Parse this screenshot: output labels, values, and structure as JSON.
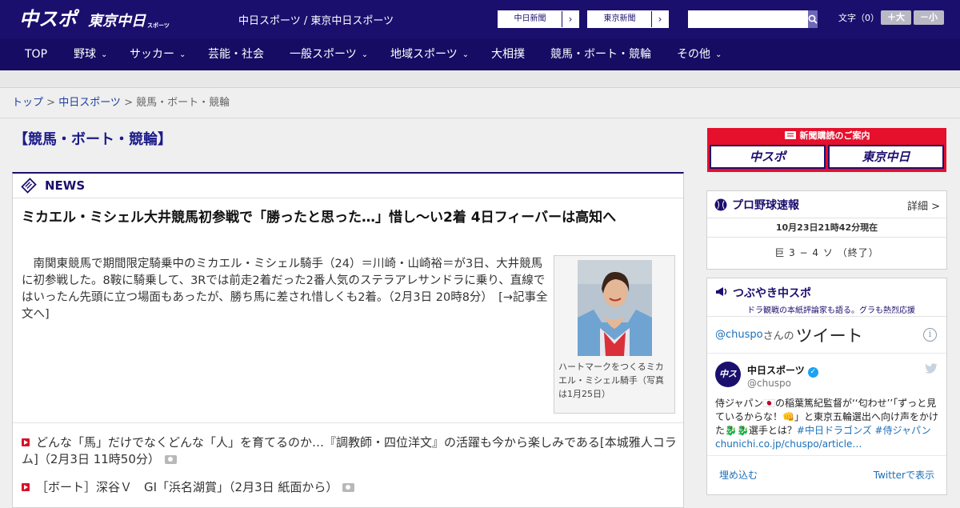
{
  "header": {
    "logo_main": "中スポ",
    "logo_sub": "東京中日",
    "logo_sub2": "スポーツ",
    "tagline": "中日スポーツ / 東京中日スポーツ",
    "btn_chunichi": "中日新聞",
    "btn_tokyo": "東京新聞",
    "arrow": "›",
    "search_placeholder": "",
    "font_label": "文字（0）",
    "font_bigger": "＋大",
    "font_smaller": "－小"
  },
  "nav": {
    "items": [
      {
        "label": "TOP",
        "dropdown": false
      },
      {
        "label": "野球",
        "dropdown": true
      },
      {
        "label": "サッカー",
        "dropdown": true
      },
      {
        "label": "芸能・社会",
        "dropdown": false
      },
      {
        "label": "一般スポーツ",
        "dropdown": true
      },
      {
        "label": "地域スポーツ",
        "dropdown": true
      },
      {
        "label": "大相撲",
        "dropdown": false
      },
      {
        "label": "競馬・ボート・競輪",
        "dropdown": false
      },
      {
        "label": "その他",
        "dropdown": true
      }
    ],
    "chevron": "⌄"
  },
  "breadcrumb": {
    "home": "トップ",
    "sep": " > ",
    "section": "中日スポーツ",
    "current": "競馬・ボート・競輪"
  },
  "page": {
    "category_title": "【競馬・ボート・競輪】"
  },
  "news": {
    "section_title": "NEWS",
    "headline": "ミカエル・ミシェル大井競馬初参戦で「勝ったと思った…」惜し～い2着 4日フィーバーは高知へ",
    "lead": "　南関東競馬で期間限定騎乗中のミカエル・ミシェル騎手（24）＝川崎・山崎裕＝が3日、大井競馬に初参戦した。8鞍に騎乗して、3Rでは前走2着だった2番人気のステラアレサンドラに乗り、直線ではいったん先頭に立つ場面もあったが、勝ち馬に差され惜しくも2着。（2月3日 20時8分）　",
    "read_more": "[→記事全文へ]",
    "photo_caption": "ハートマークをつくるミカエル・ミシェル騎手（写真は1月25日）",
    "items": [
      {
        "text": "どんな「馬」だけでなくどんな「人」を育てるのか…『調教師・四位洋文』の活躍も今から楽しみである[本城雅人コラム]（2月3日 11時50分）",
        "photo": true
      },
      {
        "text": "［ボート］深谷Ｖ　GI「浜名湖賞」（2月3日 紙面から）",
        "photo": true
      }
    ]
  },
  "sidebar": {
    "subscribe_title": "新聞購読のご案内",
    "subscribe_a": "中スポ",
    "subscribe_b": "東京中日",
    "baseball_title": "プロ野球速報",
    "baseball_more": "詳細 >",
    "baseball_time": "10月23日21時42分現在",
    "baseball_score": "巨 3 − 4 ソ （終了）",
    "tw_title": "つぶやき中スポ",
    "tw_subtitle": "ドラ観戦の本紙評論家も語る。グラも熱烈応援",
    "tw_handle": "@chuspo",
    "tw_suffix": "さんの",
    "tw_word": "ツイート",
    "tw_info": "i",
    "tw_name": "中日スポーツ",
    "tw_at": "@chuspo",
    "avatar_text": "中スポ",
    "tw_text_1": "侍ジャパン🇯🇵の稲葉篤紀監督が‘‘匂わせ’’「ずっと見ているからな！👊」と東京五輪選出へ向け声をかけた🐉🐉選手とは？",
    "tw_text_2": "#中日ドラゴンズ #侍ジャパン chunichi.co.jp/chuspo/article…",
    "tw_embed": "埋め込む",
    "tw_view": "Twitterで表示"
  },
  "colors": {
    "navy": "#1b0f6e",
    "red": "#e60f2c",
    "link": "#1b6fb8"
  }
}
